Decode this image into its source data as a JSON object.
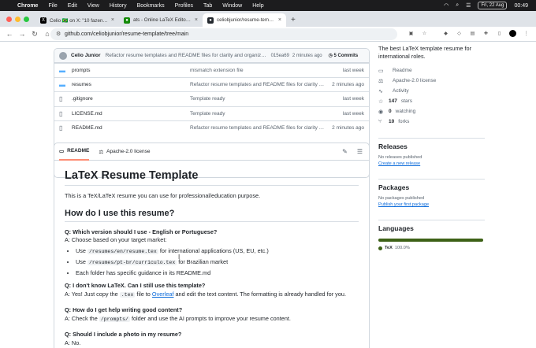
{
  "menubar": {
    "app": "Chrome",
    "items": [
      "File",
      "Edit",
      "View",
      "History",
      "Bookmarks",
      "Profiles",
      "Tab",
      "Window",
      "Help"
    ],
    "date": "Fri, 22 Aug",
    "time": "00:49"
  },
  "tabs": [
    {
      "title": "Celio 🇧🇷 on X: \"10 fazendo o t...",
      "active": false
    },
    {
      "title": "ats - Online LaTeX Editor Over...",
      "active": false
    },
    {
      "title": "celiobjunior/resume-template...",
      "active": true
    }
  ],
  "address": {
    "url": "github.com/celiobjunior/resume-template/tree/main"
  },
  "commit": {
    "author": "Celio Junior",
    "message": "Refactor resume templates and README files for clarity and organizat...",
    "hash": "015ea69",
    "time": "2 minutes ago",
    "count": "5 Commits"
  },
  "files": [
    {
      "type": "folder",
      "name": "prompts",
      "message": "mismatch extension file",
      "time": "last week"
    },
    {
      "type": "folder",
      "name": "resumes",
      "message": "Refactor resume templates and README files for clarity a...",
      "time": "2 minutes ago"
    },
    {
      "type": "file",
      "name": ".gitignore",
      "message": "Template ready",
      "time": "last week"
    },
    {
      "type": "file",
      "name": "LICENSE.md",
      "message": "Template ready",
      "time": "last week"
    },
    {
      "type": "file",
      "name": "README.md",
      "message": "Refactor resume templates and README files for clarity a...",
      "time": "2 minutes ago"
    }
  ],
  "readme_tabs": {
    "readme": "README",
    "license": "Apache-2.0 license"
  },
  "readme": {
    "title": "LaTeX Resume Template",
    "intro": "This is a TeX/LaTeX resume you can use for professional/education purpose.",
    "h2": "How do I use this resume?",
    "q1": "Q: Which version should I use - English or Portuguese?",
    "a1": "A: Choose based on your target market:",
    "b1_pre": "Use ",
    "b1_code": "/resumes/en/resume.tex",
    "b1_post": " for international applications (US, EU, etc.)",
    "b2_pre": "Use ",
    "b2_code": "/resumes/pt-br/curriculo.tex",
    "b2_post": " for Brazilian market",
    "b3": "Each folder has specific guidance in its README.md",
    "q2": "Q: I don't know LaTeX. Can I still use this template?",
    "a2_pre": "A: Yes! Just copy the ",
    "a2_code": ".tex",
    "a2_mid": " file to ",
    "a2_link": "Overleaf",
    "a2_post": " and edit the text content. The formatting is already handled for you.",
    "q3": "Q: How do I get help writing good content?",
    "a3_pre": "A: Check the ",
    "a3_code": "/prompts/",
    "a3_post": " folder and use the AI prompts to improve your resume content.",
    "q4": "Q: Should I include a photo in my resume?",
    "a4": "A: No."
  },
  "sidebar": {
    "about": "The best LaTeX template resume for international roles.",
    "stats": [
      {
        "icon": "book-icon",
        "glyph": "▭",
        "label": "Readme",
        "bold": ""
      },
      {
        "icon": "scale-icon",
        "glyph": "⚖",
        "label": "Apache-2.0 license",
        "bold": ""
      },
      {
        "icon": "pulse-icon",
        "glyph": "∿",
        "label": "Activity",
        "bold": ""
      },
      {
        "icon": "star-icon",
        "glyph": "☆",
        "label": "stars",
        "bold": "147"
      },
      {
        "icon": "eye-icon",
        "glyph": "◉",
        "label": "watching",
        "bold": "0"
      },
      {
        "icon": "fork-icon",
        "glyph": "⑂",
        "label": "forks",
        "bold": "10"
      }
    ],
    "releases": {
      "heading": "Releases",
      "text": "No releases published",
      "link": "Create a new release"
    },
    "packages": {
      "heading": "Packages",
      "text": "No packages published",
      "link": "Publish your first package"
    },
    "languages": {
      "heading": "Languages",
      "name": "TeX",
      "percent": "100.0%",
      "share": 1.0,
      "color": "#3d6117"
    }
  }
}
